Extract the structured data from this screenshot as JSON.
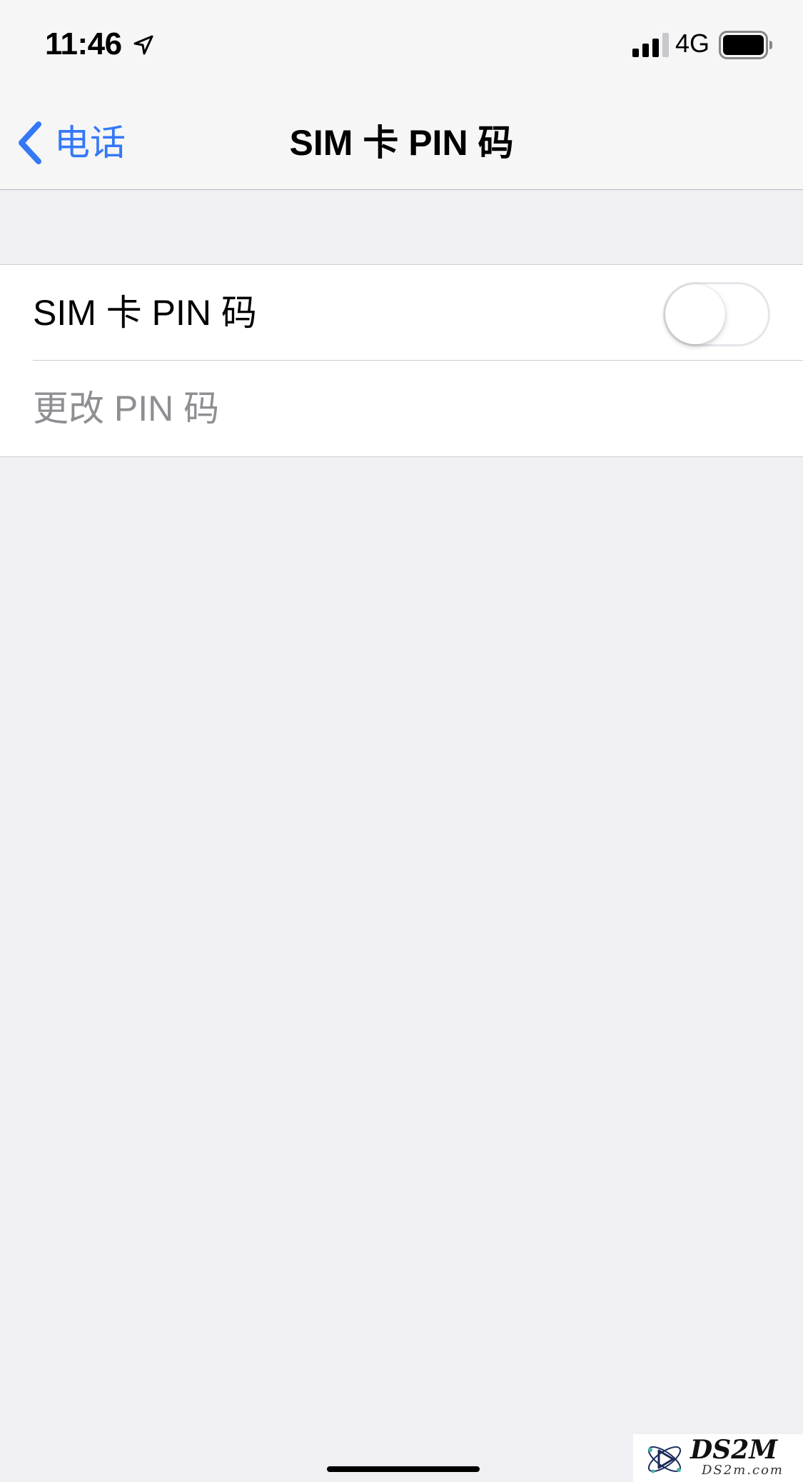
{
  "status_bar": {
    "time": "11:46",
    "network": "4G",
    "icons": [
      "location-arrow-icon",
      "cellular-signal-icon",
      "battery-icon"
    ]
  },
  "nav": {
    "back_label": "电话",
    "title": "SIM 卡 PIN 码"
  },
  "settings": {
    "sim_pin_label": "SIM 卡 PIN 码",
    "sim_pin_enabled": false,
    "change_pin_label": "更改 PIN 码",
    "change_pin_enabled": false
  },
  "watermark": {
    "brand": "DS2M",
    "domain": "DS2m.com"
  },
  "colors": {
    "accent": "#3478f6",
    "background": "#efeff4",
    "bar_background": "#f6f6f7",
    "disabled_text": "#8e8e93",
    "separator": "#cfcfd3"
  }
}
